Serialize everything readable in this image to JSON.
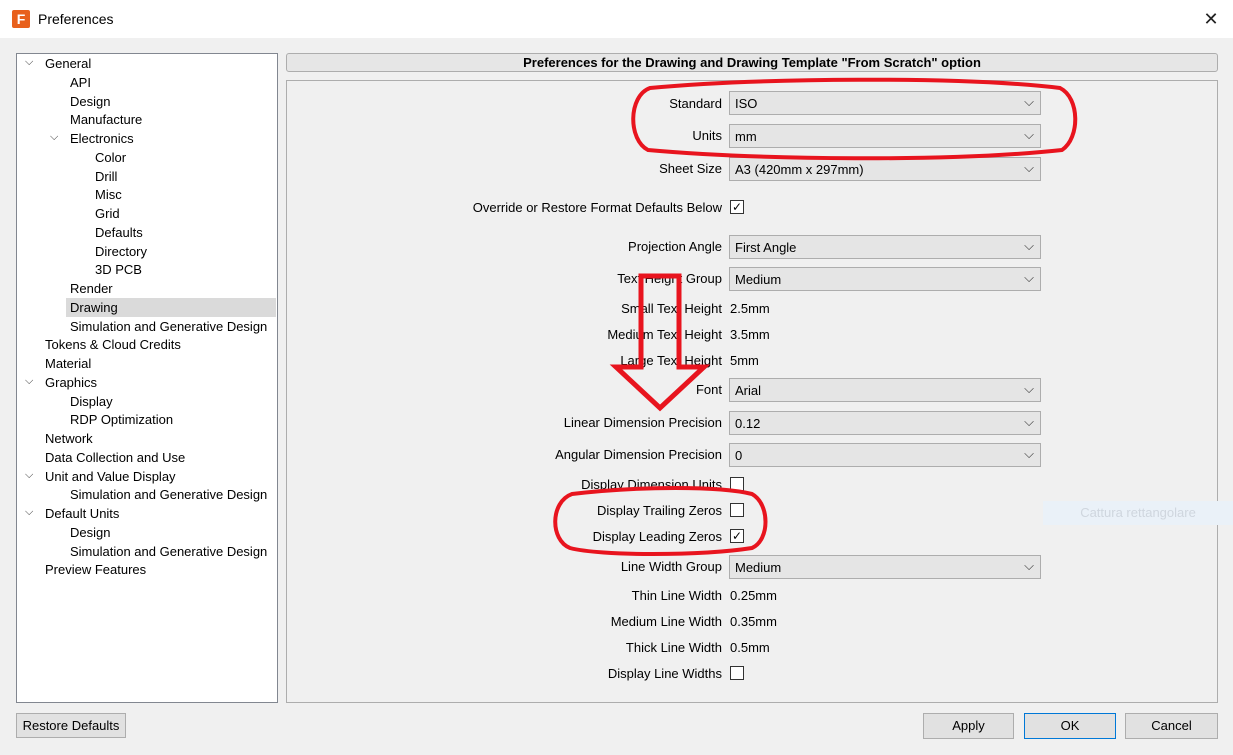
{
  "window": {
    "title": "Preferences",
    "app_icon": "fusion-app-icon",
    "close_glyph": "✕"
  },
  "tree": {
    "items": [
      {
        "label": "General",
        "expanded": true
      },
      {
        "label": "API"
      },
      {
        "label": "Design"
      },
      {
        "label": "Manufacture"
      },
      {
        "label": "Electronics",
        "expanded": true
      },
      {
        "label": "Color"
      },
      {
        "label": "Drill"
      },
      {
        "label": "Misc"
      },
      {
        "label": "Grid"
      },
      {
        "label": "Defaults"
      },
      {
        "label": "Directory"
      },
      {
        "label": "3D PCB"
      },
      {
        "label": "Render"
      },
      {
        "label": "Drawing",
        "selected": true
      },
      {
        "label": "Simulation and Generative Design"
      },
      {
        "label": "Tokens & Cloud Credits"
      },
      {
        "label": "Material"
      },
      {
        "label": "Graphics",
        "expanded": true
      },
      {
        "label": "Display"
      },
      {
        "label": "RDP Optimization"
      },
      {
        "label": "Network"
      },
      {
        "label": "Data Collection and Use"
      },
      {
        "label": "Unit and Value Display",
        "expanded": true
      },
      {
        "label": "Simulation and Generative Design"
      },
      {
        "label": "Default Units",
        "expanded": true
      },
      {
        "label": "Design"
      },
      {
        "label": "Simulation and Generative Design"
      },
      {
        "label": "Preview Features"
      }
    ]
  },
  "panel": {
    "header": "Preferences for the Drawing and Drawing Template \"From Scratch\" option",
    "standard": {
      "label": "Standard",
      "value": "ISO"
    },
    "units": {
      "label": "Units",
      "value": "mm"
    },
    "sheet_size": {
      "label": "Sheet Size",
      "value": "A3 (420mm x 297mm)"
    },
    "override": {
      "label": "Override or Restore Format Defaults Below",
      "checked": true
    },
    "projection_angle": {
      "label": "Projection Angle",
      "value": "First Angle"
    },
    "text_height_group": {
      "label": "Text Height Group",
      "value": "Medium"
    },
    "small_text_height": {
      "label": "Small Text Height",
      "value": "2.5mm"
    },
    "medium_text_height": {
      "label": "Medium Text Height",
      "value": "3.5mm"
    },
    "large_text_height": {
      "label": "Large Text Height",
      "value": "5mm"
    },
    "font": {
      "label": "Font",
      "value": "Arial"
    },
    "linear_precision": {
      "label": "Linear Dimension Precision",
      "value": "0.12"
    },
    "angular_precision": {
      "label": "Angular Dimension Precision",
      "value": "0"
    },
    "display_dim_units": {
      "label": "Display Dimension Units",
      "checked": false
    },
    "trailing_zeros": {
      "label": "Display Trailing Zeros",
      "checked": false
    },
    "leading_zeros": {
      "label": "Display Leading Zeros",
      "checked": true
    },
    "line_width_group": {
      "label": "Line Width Group",
      "value": "Medium"
    },
    "thin_line_width": {
      "label": "Thin Line Width",
      "value": "0.25mm"
    },
    "medium_line_width": {
      "label": "Medium Line Width",
      "value": "0.35mm"
    },
    "thick_line_width": {
      "label": "Thick Line Width",
      "value": "0.5mm"
    },
    "display_line_widths": {
      "label": "Display Line Widths",
      "checked": false
    }
  },
  "buttons": {
    "restore_defaults": "Restore Defaults",
    "apply": "Apply",
    "ok": "OK",
    "cancel": "Cancel"
  },
  "ghost_tooltip": "Cattura rettangolare",
  "annotation_color": "#e8141e",
  "icons": {
    "chevron_expanded": "⌵",
    "dropdown_arrow": "⌵",
    "check": "✓"
  }
}
